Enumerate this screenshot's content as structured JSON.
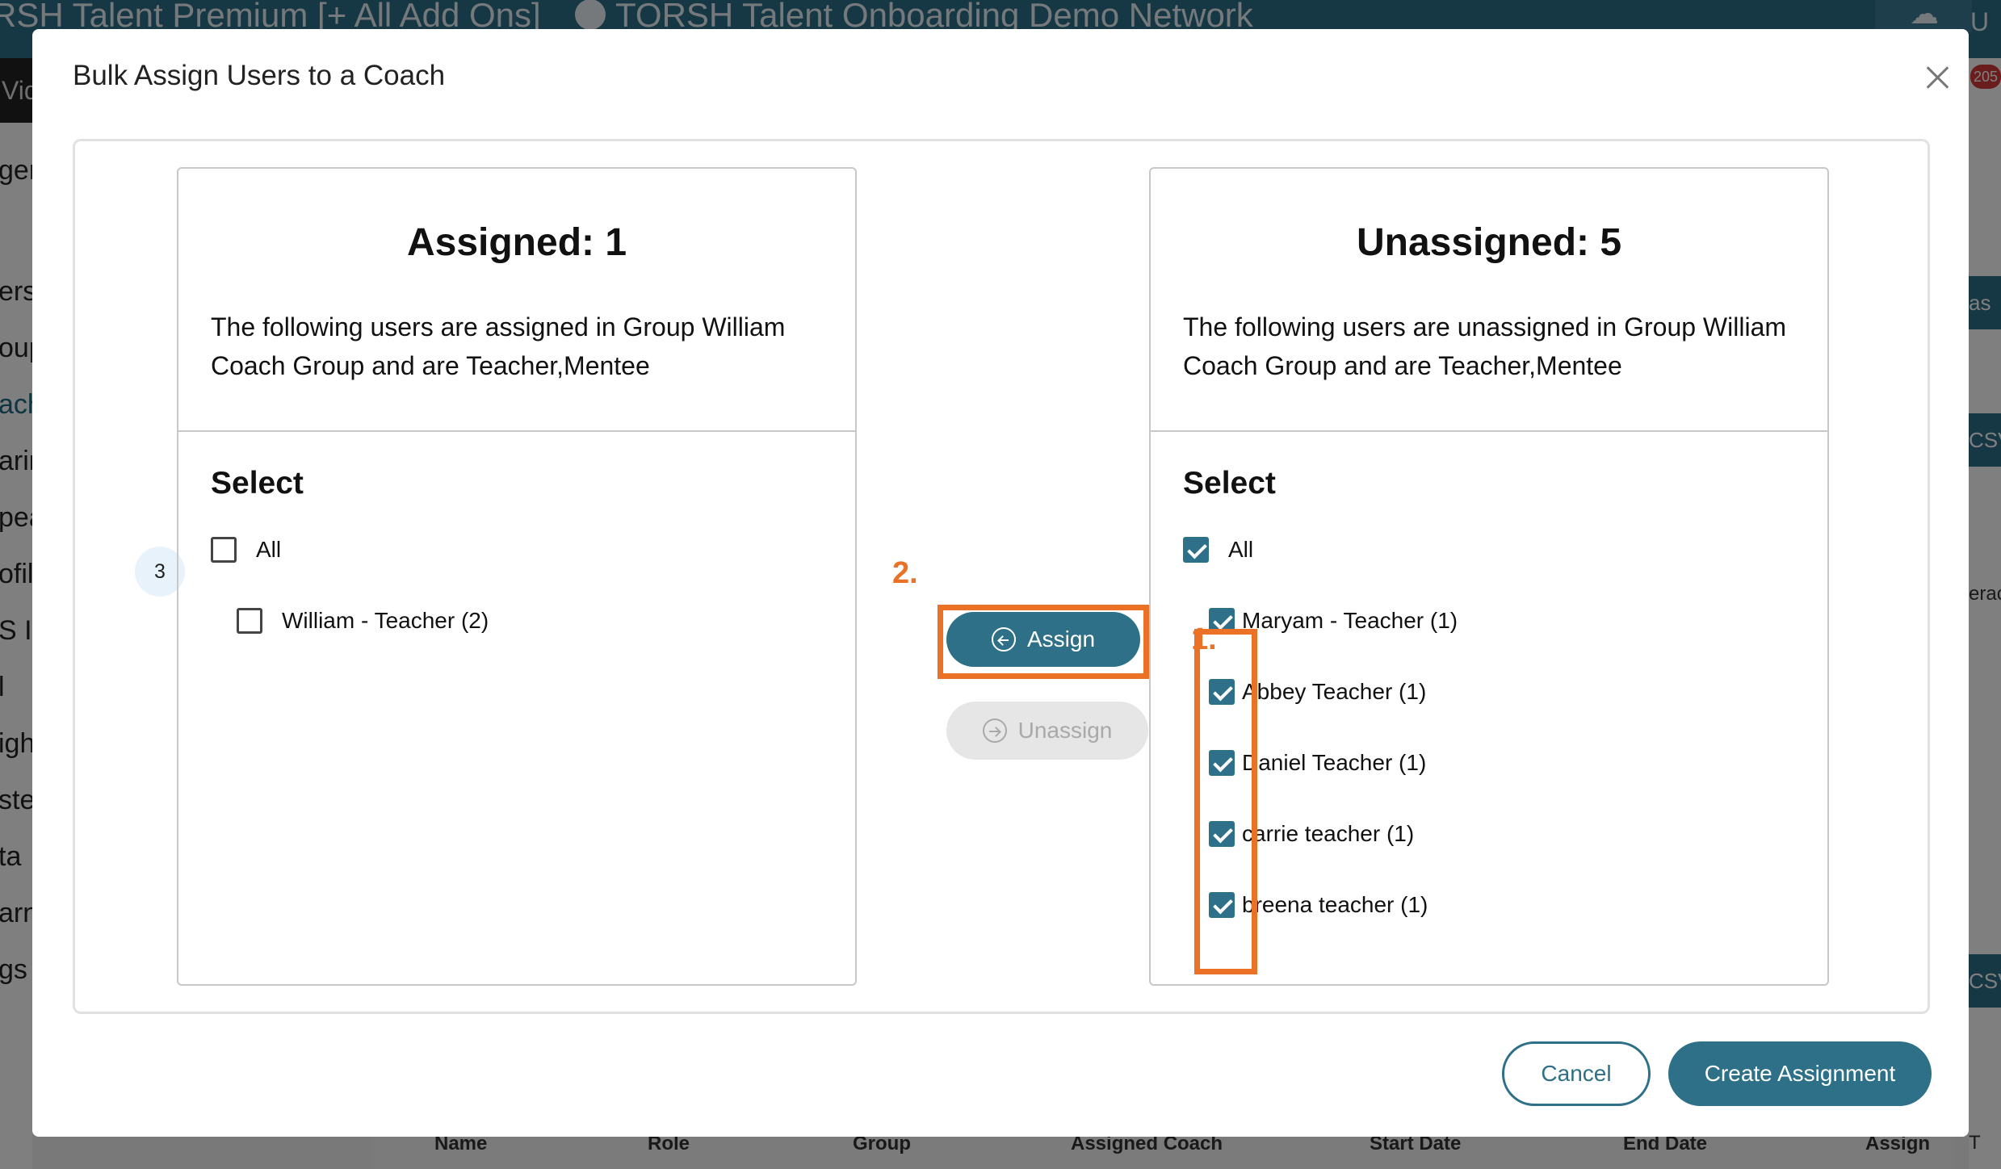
{
  "background": {
    "top_bar_left": "RSH Talent Premium [+ All Add Ons]",
    "top_bar_center": "TORSH Talent Onboarding Demo Network",
    "top_bar_right": "U",
    "nav_text": "Vid",
    "notification_count": "205",
    "header_fragment": "gem",
    "sidebar_items": [
      "ers",
      "oup",
      "ach",
      "arin",
      "pea",
      "ofil",
      "S I",
      "l",
      "igh",
      "ste",
      "ta",
      "arn",
      "gs"
    ],
    "right_fragments": [
      "as",
      "CSV",
      "erac",
      "CSV",
      "T"
    ],
    "table_headers": [
      "Name",
      "Role",
      "Group",
      "Assigned Coach",
      "Start Date",
      "End Date",
      "Assign"
    ]
  },
  "modal": {
    "title": "Bulk Assign Users to a Coach",
    "step_number": "3",
    "assigned": {
      "title": "Assigned: 1",
      "description": "The following users are assigned in Group William Coach Group and are Teacher,Mentee",
      "select_label": "Select",
      "all_label": "All",
      "all_checked": false,
      "users": [
        {
          "label": "William - Teacher (2)",
          "checked": false
        }
      ]
    },
    "unassigned": {
      "title": "Unassigned: 5",
      "description": "The following users are unassigned in Group William Coach Group and are Teacher,Mentee",
      "select_label": "Select",
      "all_label": "All",
      "all_checked": true,
      "users": [
        {
          "label": "Maryam - Teacher (1)",
          "checked": true
        },
        {
          "label": "Abbey Teacher (1)",
          "checked": true
        },
        {
          "label": "Daniel Teacher (1)",
          "checked": true
        },
        {
          "label": "carrie teacher (1)",
          "checked": true
        },
        {
          "label": "breena teacher (1)",
          "checked": true
        }
      ]
    },
    "assign_label": "Assign",
    "unassign_label": "Unassign",
    "cancel_label": "Cancel",
    "create_label": "Create Assignment"
  },
  "annotations": {
    "step1_label": "1.",
    "step2_label": "2.",
    "highlight_color": "#ea7125"
  },
  "colors": {
    "primary": "#2d7088",
    "highlight": "#ea7125",
    "disabled_bg": "#e6e6e6"
  }
}
